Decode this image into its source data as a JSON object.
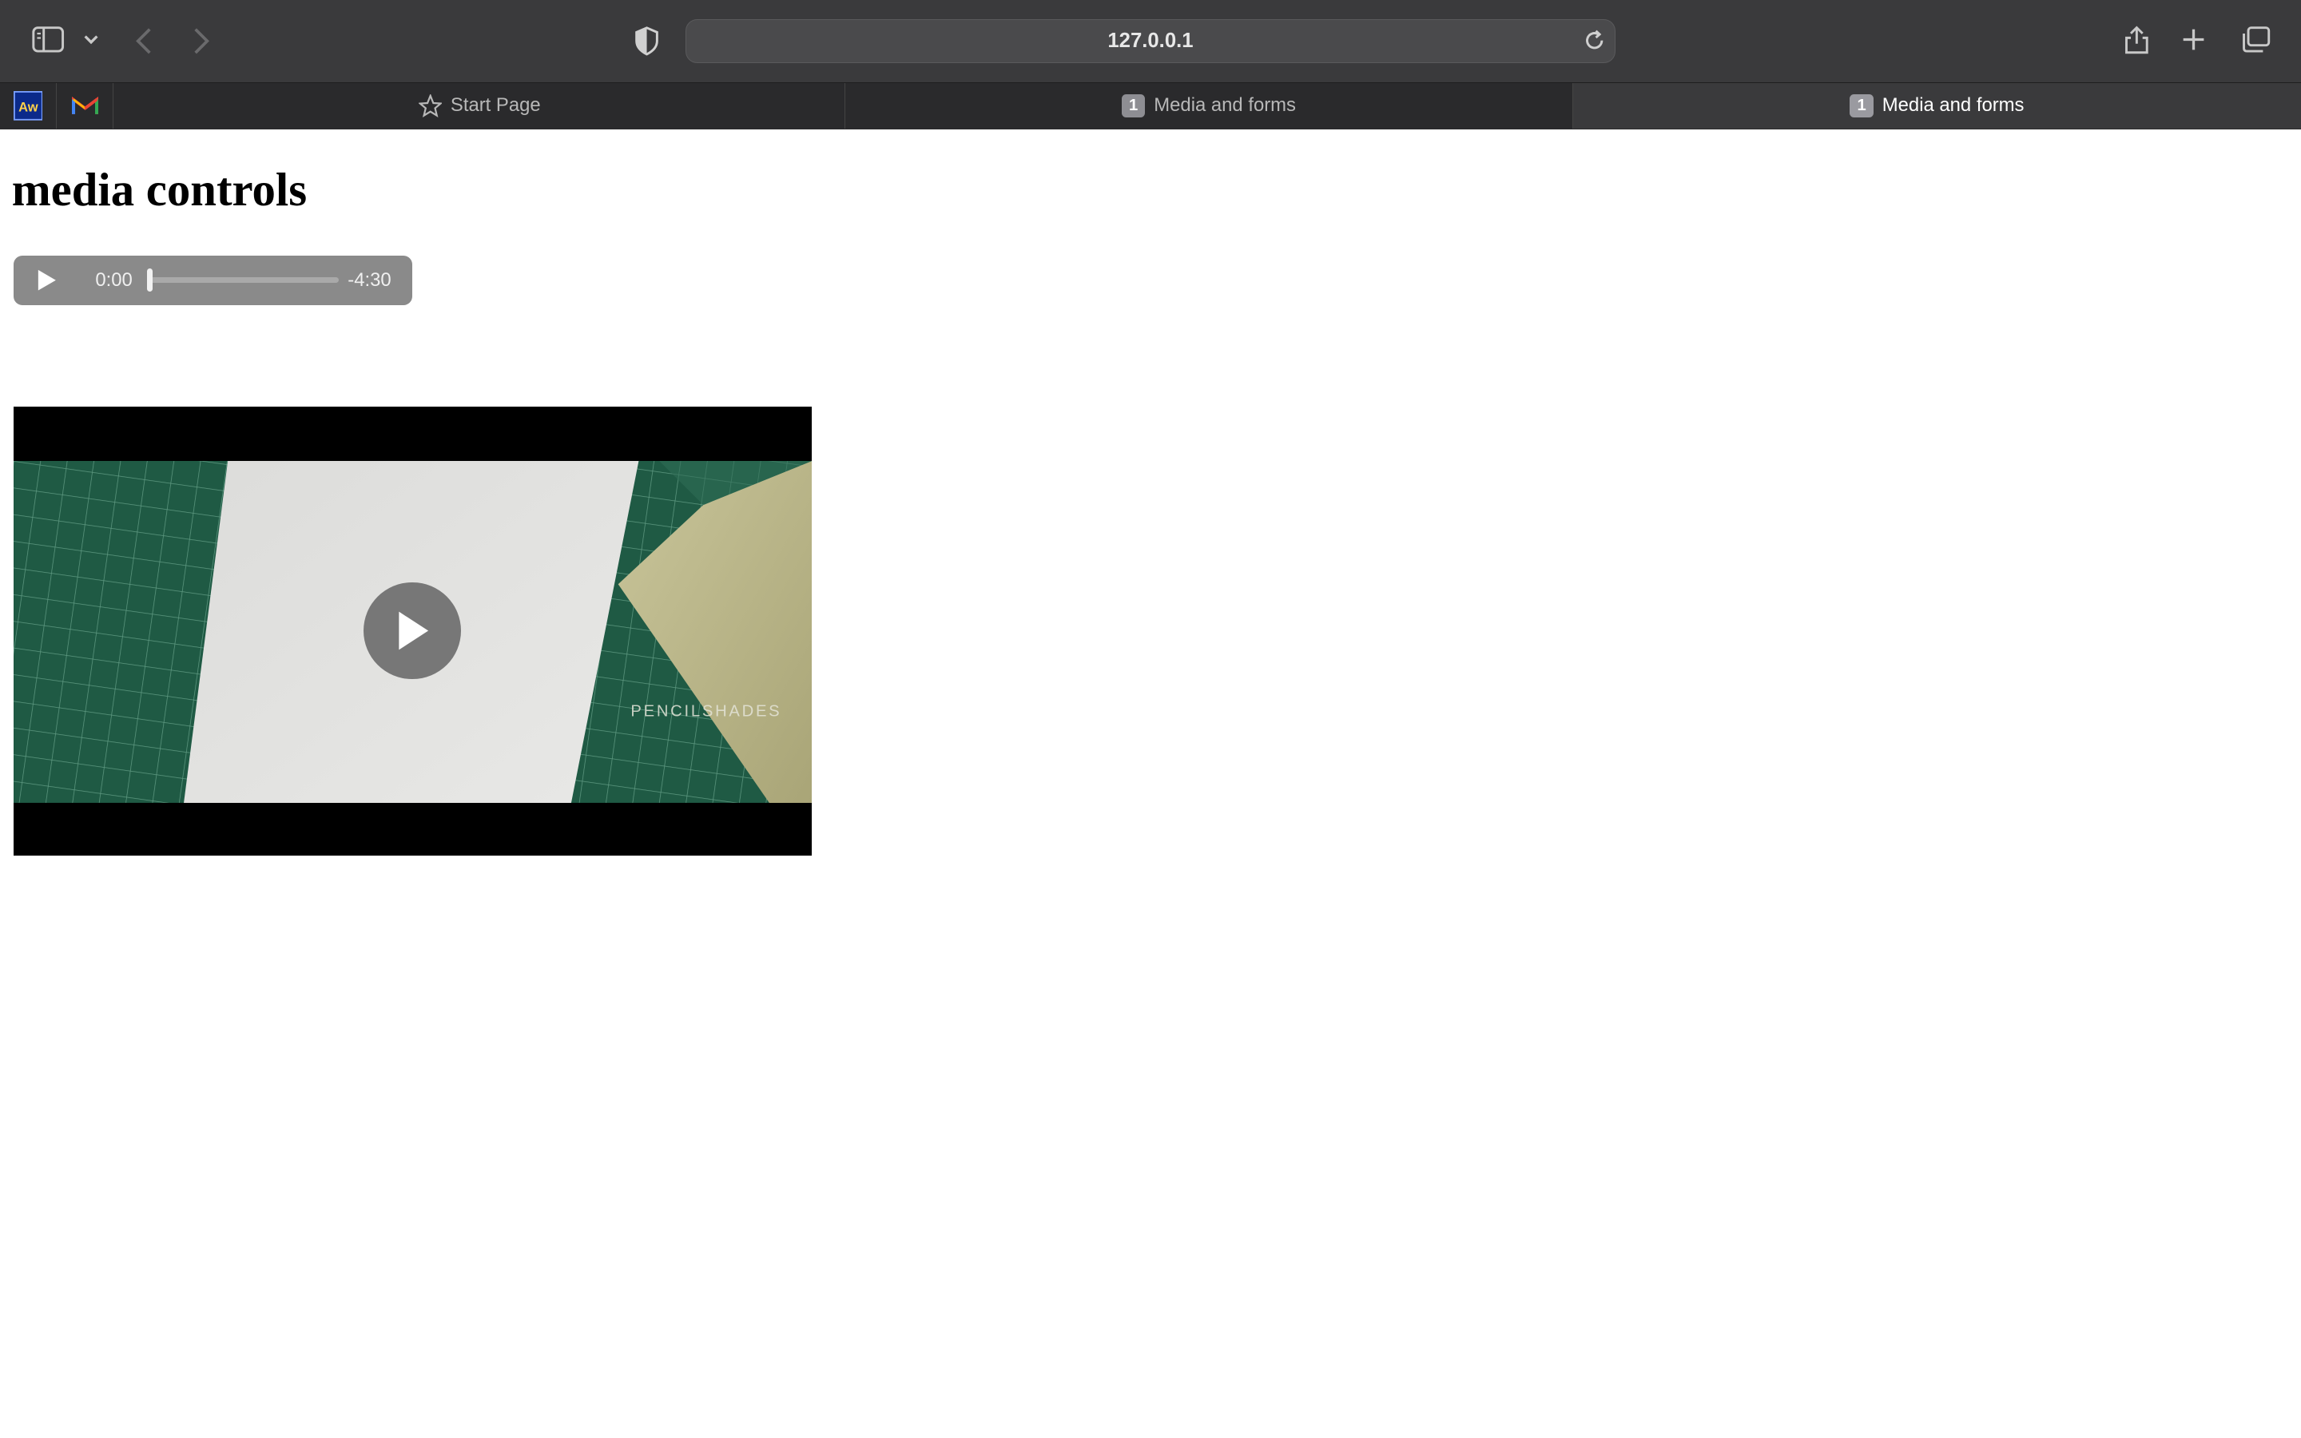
{
  "toolbar": {
    "url": "127.0.0.1",
    "icons": [
      "sidebar-icon",
      "chevron-down-icon",
      "back-icon",
      "forward-icon",
      "privacy-shield-icon",
      "reload-icon",
      "share-icon",
      "new-tab-icon",
      "tab-overview-icon"
    ]
  },
  "favorites": [
    {
      "name": "aw-favicon",
      "label": "Aw"
    },
    {
      "name": "gmail-favicon",
      "label": "M"
    }
  ],
  "tabs": [
    {
      "label": "Start Page",
      "icon": "star-icon",
      "active": false
    },
    {
      "label": "Media and forms",
      "badge": "1",
      "active": false
    },
    {
      "label": "Media and forms",
      "badge": "1",
      "active": true
    }
  ],
  "page": {
    "heading": "media controls",
    "audio": {
      "current_time": "0:00",
      "remaining_time": "-4:30",
      "progress": 0
    },
    "video": {
      "watermark": "PENCILSHADES"
    }
  },
  "colors": {
    "toolbar_bg": "#3a3a3c",
    "tabbar_bg": "#2a2a2c",
    "audio_bg": "#8a8a8a",
    "cutting_mat": "#1f5a44"
  }
}
